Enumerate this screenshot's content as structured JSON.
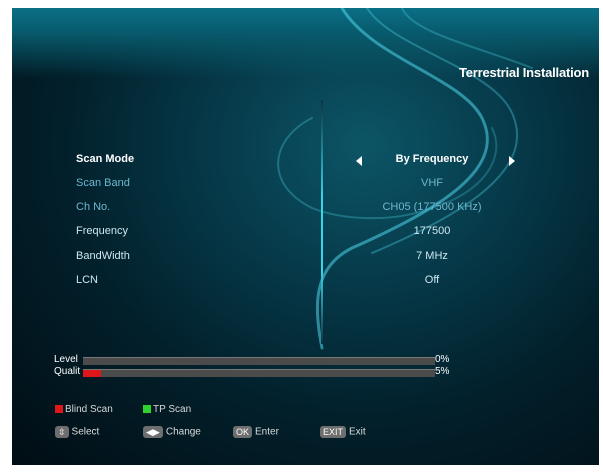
{
  "header": {
    "title": "Terrestrial Installation"
  },
  "settings": [
    {
      "label": "Scan Mode",
      "value": "By Frequency",
      "state": "selected"
    },
    {
      "label": "Scan Band",
      "value": "VHF",
      "state": "dim"
    },
    {
      "label": "Ch No.",
      "value": "CH05 (177500 KHz)",
      "state": "dim"
    },
    {
      "label": "Frequency",
      "value": "177500",
      "state": "normal"
    },
    {
      "label": "BandWidth",
      "value": "7 MHz",
      "state": "normal"
    },
    {
      "label": "LCN",
      "value": "Off",
      "state": "normal"
    }
  ],
  "signal": {
    "level": {
      "label": "Level",
      "percent_text": "0%",
      "fraction": 0.0
    },
    "quality": {
      "label": "Qualit",
      "percent_text": "5%",
      "fraction": 0.05
    }
  },
  "footer": {
    "blind_scan": {
      "label": "Blind Scan",
      "color": "#e0171a"
    },
    "tp_scan": {
      "label": "TP Scan",
      "color": "#2fd12f"
    },
    "select": {
      "key": "⇳",
      "label": "Select"
    },
    "change": {
      "key": "◀▶",
      "label": "Change"
    },
    "enter": {
      "key": "OK",
      "label": "Enter"
    },
    "exit": {
      "key": "EXIT",
      "label": "Exit"
    }
  },
  "colors": {
    "accent": "#39d3ea",
    "signal_fill": "#e0171a"
  }
}
